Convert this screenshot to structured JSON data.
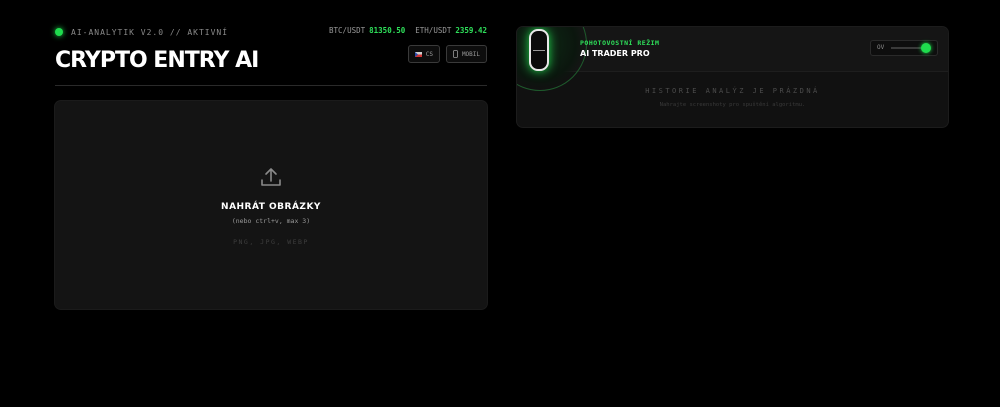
{
  "header": {
    "status": "AI-ANALYTIK V2.0 // AKTIVNÍ",
    "title": "CRYPTO ENTRY AI",
    "tickers": [
      {
        "pair": "BTC/USDT",
        "price": "81350.50"
      },
      {
        "pair": "ETH/USDT",
        "price": "2359.42"
      }
    ],
    "buttons": {
      "language": "CS",
      "mobile": "MOBIL"
    }
  },
  "upload": {
    "title": "NAHRÁT OBRÁZKY",
    "hint": "(nebo ctrl+v, max 3)",
    "formats": "PNG, JPG, WEBP"
  },
  "panel": {
    "mode_label": "POHOTOVOSTNÍ REŽIM",
    "mode_name": "AI TRADER PRO",
    "toggle_label": "OV",
    "empty_title": "HISTORIE ANALÝZ JE PRÁZDNÁ",
    "empty_subtitle": "Nahrajte screenshoty pro spuštění algoritmu."
  },
  "colors": {
    "accent": "#1fdc4e",
    "background": "#000000",
    "card": "#141414"
  },
  "icons": [
    "status-dot",
    "upload-icon",
    "flag-icon",
    "phone-icon",
    "power-pill-icon"
  ]
}
